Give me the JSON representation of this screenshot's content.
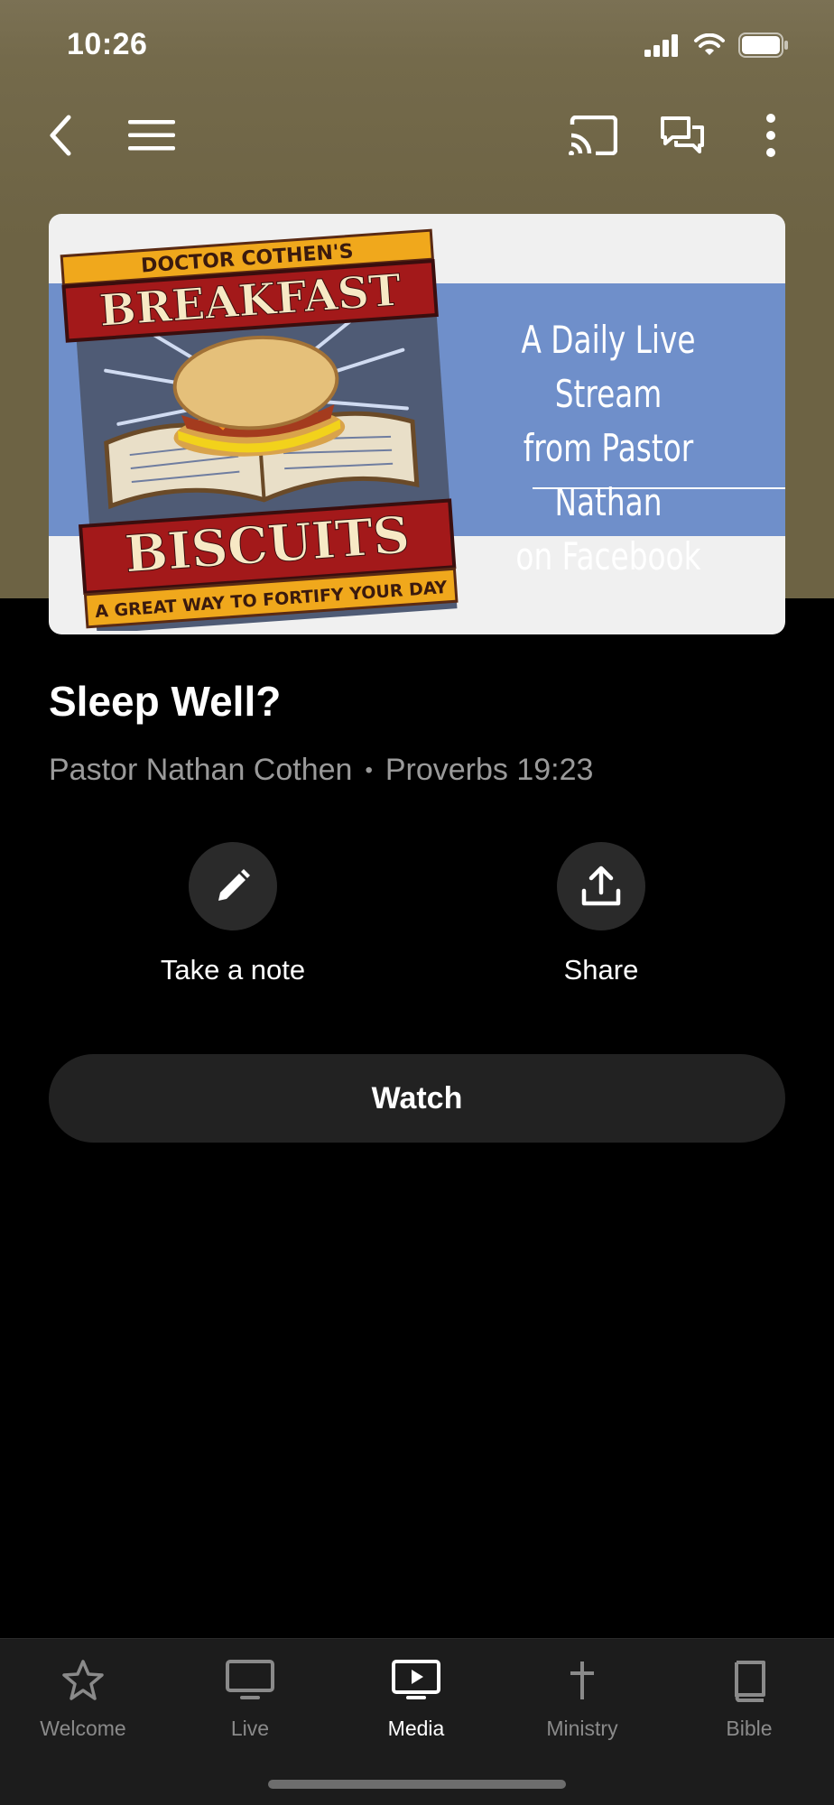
{
  "status_bar": {
    "time": "10:26"
  },
  "nav": {
    "back_icon": "chevron-left-icon",
    "menu_icon": "hamburger-menu-icon",
    "cast_icon": "cast-icon",
    "chat_icon": "chat-bubbles-icon",
    "more_icon": "more-vertical-icon"
  },
  "banner": {
    "logo_top": "DOCTOR COTHEN'S",
    "logo_main": "BREAKFAST",
    "logo_bottom": "BISCUITS",
    "logo_tagline": "A GREAT WAY TO FORTIFY YOUR DAY",
    "line1": "A Daily Live Stream",
    "line2": "from Pastor Nathan",
    "line3": "on Facebook",
    "stripe_color": "#6f8fca"
  },
  "media": {
    "title": "Sleep Well?",
    "speaker": "Pastor Nathan Cothen",
    "separator": "•",
    "scripture": "Proverbs 19:23"
  },
  "actions": {
    "note_label": "Take a note",
    "share_label": "Share",
    "watch_label": "Watch"
  },
  "tabs": [
    {
      "label": "Welcome",
      "icon": "star-icon",
      "active": false
    },
    {
      "label": "Live",
      "icon": "monitor-icon",
      "active": false
    },
    {
      "label": "Media",
      "icon": "play-screen-icon",
      "active": true
    },
    {
      "label": "Ministry",
      "icon": "cross-icon",
      "active": false
    },
    {
      "label": "Bible",
      "icon": "book-icon",
      "active": false
    }
  ]
}
